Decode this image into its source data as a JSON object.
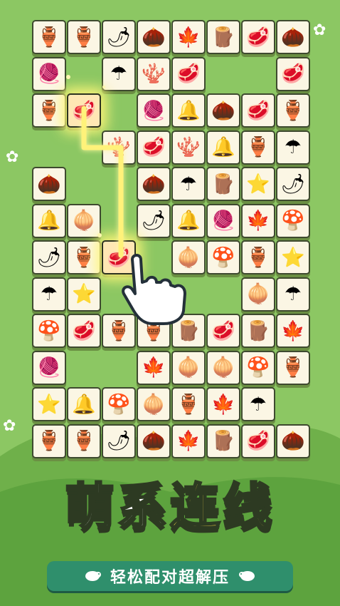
{
  "title": {
    "part1": "萌系",
    "part2": "连线"
  },
  "subtitle": "轻松配对超解压",
  "icons": {
    "pot": "🏺",
    "pepper": "🌶",
    "acorn": "🌰",
    "leaf": "🍁",
    "meat": "🥩",
    "wood": "🪵",
    "yarn": "🧶",
    "coral": "🪸",
    "umbrella": "☂",
    "bell": "🔔",
    "star": "⭐",
    "onion": "🧅",
    "mushroom": "🍄"
  },
  "tiles": [
    {
      "row": 0,
      "col": 0,
      "icon": "pot"
    },
    {
      "row": 0,
      "col": 1,
      "icon": "pot"
    },
    {
      "row": 0,
      "col": 2,
      "icon": "pepper"
    },
    {
      "row": 0,
      "col": 3,
      "icon": "acorn"
    },
    {
      "row": 0,
      "col": 4,
      "icon": "leaf"
    },
    {
      "row": 0,
      "col": 5,
      "icon": "wood"
    },
    {
      "row": 0,
      "col": 6,
      "icon": "meat"
    },
    {
      "row": 0,
      "col": 7,
      "icon": "acorn"
    },
    {
      "row": 1,
      "col": 0,
      "icon": "yarn"
    },
    {
      "row": 1,
      "col": 2,
      "icon": "umbrella"
    },
    {
      "row": 1,
      "col": 3,
      "icon": "coral"
    },
    {
      "row": 1,
      "col": 4,
      "icon": "meat"
    },
    {
      "row": 1,
      "col": 7,
      "icon": "meat"
    },
    {
      "row": 2,
      "col": 0,
      "icon": "pot"
    },
    {
      "row": 2,
      "col": 1,
      "icon": "meat",
      "selected": true
    },
    {
      "row": 2,
      "col": 3,
      "icon": "yarn"
    },
    {
      "row": 2,
      "col": 4,
      "icon": "bell"
    },
    {
      "row": 2,
      "col": 5,
      "icon": "acorn"
    },
    {
      "row": 2,
      "col": 6,
      "icon": "meat"
    },
    {
      "row": 2,
      "col": 7,
      "icon": "pot"
    },
    {
      "row": 3,
      "col": 2,
      "icon": "coral"
    },
    {
      "row": 3,
      "col": 3,
      "icon": "meat"
    },
    {
      "row": 3,
      "col": 4,
      "icon": "coral"
    },
    {
      "row": 3,
      "col": 5,
      "icon": "bell"
    },
    {
      "row": 3,
      "col": 6,
      "icon": "pot"
    },
    {
      "row": 3,
      "col": 7,
      "icon": "umbrella"
    },
    {
      "row": 4,
      "col": 0,
      "icon": "acorn"
    },
    {
      "row": 4,
      "col": 3,
      "icon": "acorn"
    },
    {
      "row": 4,
      "col": 4,
      "icon": "umbrella"
    },
    {
      "row": 4,
      "col": 5,
      "icon": "wood"
    },
    {
      "row": 4,
      "col": 6,
      "icon": "star"
    },
    {
      "row": 4,
      "col": 7,
      "icon": "pepper"
    },
    {
      "row": 5,
      "col": 0,
      "icon": "bell"
    },
    {
      "row": 5,
      "col": 1,
      "icon": "onion"
    },
    {
      "row": 5,
      "col": 3,
      "icon": "pepper"
    },
    {
      "row": 5,
      "col": 4,
      "icon": "bell"
    },
    {
      "row": 5,
      "col": 5,
      "icon": "yarn"
    },
    {
      "row": 5,
      "col": 6,
      "icon": "leaf"
    },
    {
      "row": 5,
      "col": 7,
      "icon": "mushroom"
    },
    {
      "row": 6,
      "col": 0,
      "icon": "pepper"
    },
    {
      "row": 6,
      "col": 1,
      "icon": "pot"
    },
    {
      "row": 6,
      "col": 2,
      "icon": "meat",
      "selected": true
    },
    {
      "row": 6,
      "col": 4,
      "icon": "onion"
    },
    {
      "row": 6,
      "col": 5,
      "icon": "mushroom"
    },
    {
      "row": 6,
      "col": 6,
      "icon": "pot"
    },
    {
      "row": 6,
      "col": 7,
      "icon": "star"
    },
    {
      "row": 7,
      "col": 0,
      "icon": "umbrella"
    },
    {
      "row": 7,
      "col": 1,
      "icon": "star"
    },
    {
      "row": 7,
      "col": 6,
      "icon": "onion"
    },
    {
      "row": 7,
      "col": 7,
      "icon": "umbrella"
    },
    {
      "row": 8,
      "col": 0,
      "icon": "mushroom"
    },
    {
      "row": 8,
      "col": 1,
      "icon": "meat"
    },
    {
      "row": 8,
      "col": 2,
      "icon": "pot"
    },
    {
      "row": 8,
      "col": 3,
      "icon": "pot"
    },
    {
      "row": 8,
      "col": 4,
      "icon": "wood"
    },
    {
      "row": 8,
      "col": 5,
      "icon": "meat"
    },
    {
      "row": 8,
      "col": 6,
      "icon": "wood"
    },
    {
      "row": 8,
      "col": 7,
      "icon": "leaf"
    },
    {
      "row": 9,
      "col": 0,
      "icon": "yarn"
    },
    {
      "row": 9,
      "col": 3,
      "icon": "leaf"
    },
    {
      "row": 9,
      "col": 4,
      "icon": "onion"
    },
    {
      "row": 9,
      "col": 5,
      "icon": "onion"
    },
    {
      "row": 9,
      "col": 6,
      "icon": "mushroom"
    },
    {
      "row": 9,
      "col": 7,
      "icon": "pot"
    },
    {
      "row": 10,
      "col": 0,
      "icon": "star"
    },
    {
      "row": 10,
      "col": 1,
      "icon": "bell"
    },
    {
      "row": 10,
      "col": 2,
      "icon": "mushroom"
    },
    {
      "row": 10,
      "col": 3,
      "icon": "onion"
    },
    {
      "row": 10,
      "col": 4,
      "icon": "pot"
    },
    {
      "row": 10,
      "col": 5,
      "icon": "leaf"
    },
    {
      "row": 10,
      "col": 6,
      "icon": "umbrella"
    },
    {
      "row": 11,
      "col": 0,
      "icon": "pot"
    },
    {
      "row": 11,
      "col": 1,
      "icon": "pot"
    },
    {
      "row": 11,
      "col": 2,
      "icon": "pepper"
    },
    {
      "row": 11,
      "col": 3,
      "icon": "acorn"
    },
    {
      "row": 11,
      "col": 4,
      "icon": "leaf"
    },
    {
      "row": 11,
      "col": 5,
      "icon": "wood"
    },
    {
      "row": 11,
      "col": 6,
      "icon": "meat"
    },
    {
      "row": 11,
      "col": 7,
      "icon": "acorn"
    }
  ],
  "colors": {
    "background": "#8cc763",
    "tile": "#fbf6e4",
    "path": "#fff27a",
    "title_yellow": "#ffe24a",
    "banner": "#2f8f6c"
  }
}
